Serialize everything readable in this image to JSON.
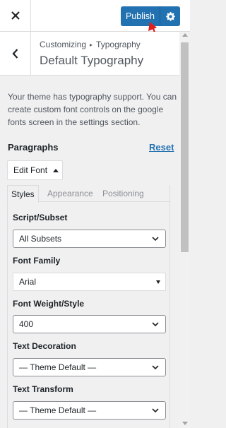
{
  "header": {
    "publish_label": "Publish"
  },
  "section": {
    "breadcrumb": [
      "Customizing",
      "Typography"
    ],
    "breadcrumb_sep": "▸",
    "title": "Default Typography"
  },
  "description": "Your theme has typography support. You can create custom font controls on the google fonts screen in the settings section.",
  "control": {
    "label": "Paragraphs",
    "reset_label": "Reset",
    "edit_font_label": "Edit Font",
    "tabs": [
      {
        "label": "Styles",
        "active": true
      },
      {
        "label": "Appearance",
        "active": false
      },
      {
        "label": "Positioning",
        "active": false
      }
    ],
    "fields": [
      {
        "label": "Script/Subset",
        "value": "All Subsets"
      },
      {
        "label": "Font Family",
        "value": "Arial"
      },
      {
        "label": "Font Weight/Style",
        "value": "400"
      },
      {
        "label": "Text Decoration",
        "value": "— Theme Default —"
      },
      {
        "label": "Text Transform",
        "value": "— Theme Default —"
      }
    ]
  },
  "colors": {
    "accent": "#2271b1",
    "annotation_arrow": "#e02020"
  },
  "icons": [
    "close-icon",
    "gear-icon",
    "back-chevron-icon",
    "chevron-down-icon",
    "triangle-up-icon"
  ]
}
